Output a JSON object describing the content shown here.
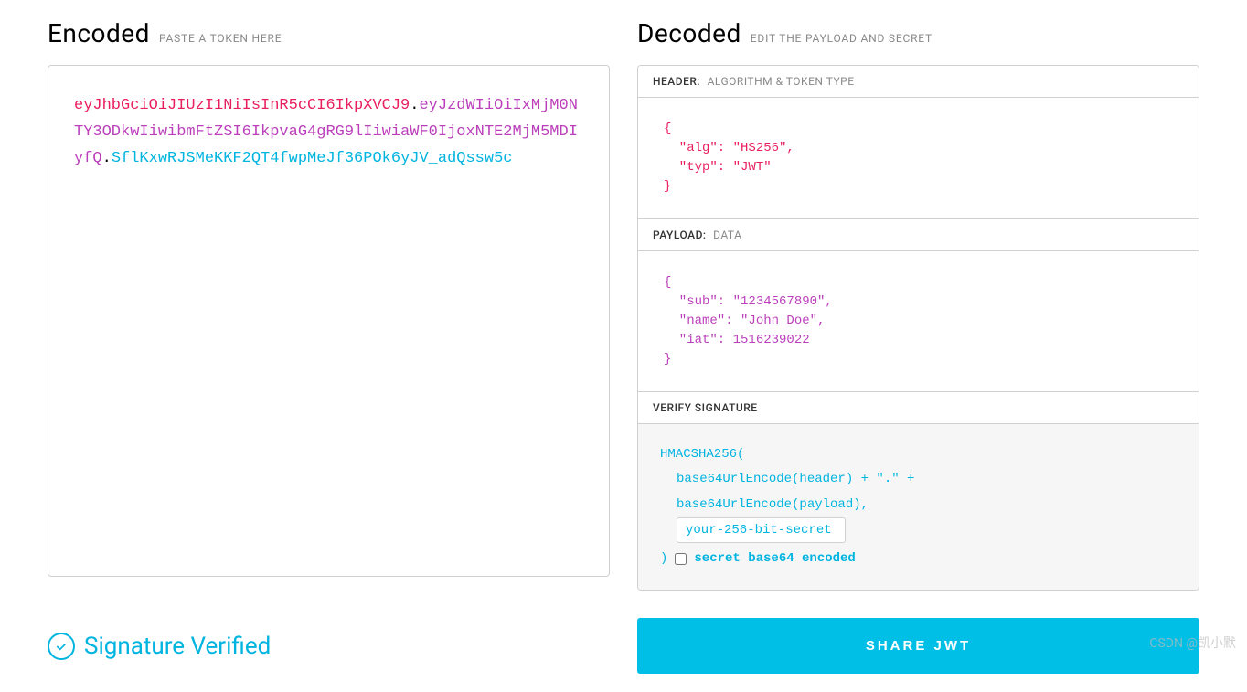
{
  "encoded": {
    "title": "Encoded",
    "subtitle": "PASTE A TOKEN HERE",
    "token_header": "eyJhbGciOiJIUzI1NiIsInR5cCI6IkpXVCJ9",
    "token_payload": "eyJzdWIiOiIxMjM0NTY3ODkwIiwibmFtZSI6IkpvaG4gRG9lIiwiaWF0IjoxNTE2MjM5MDIyfQ",
    "token_signature": "SflKxwRJSMeKKF2QT4fwpMeJf36POk6yJV_adQssw5c"
  },
  "decoded": {
    "title": "Decoded",
    "subtitle": "EDIT THE PAYLOAD AND SECRET",
    "header_label": "HEADER:",
    "header_sub": "ALGORITHM & TOKEN TYPE",
    "header_json": "{\n  \"alg\": \"HS256\",\n  \"typ\": \"JWT\"\n}",
    "payload_label": "PAYLOAD:",
    "payload_sub": "DATA",
    "payload_json": "{\n  \"sub\": \"1234567890\",\n  \"name\": \"John Doe\",\n  \"iat\": 1516239022\n}",
    "signature_label": "VERIFY SIGNATURE",
    "signature": {
      "line1": "HMACSHA256(",
      "line2": "base64UrlEncode(header) + \".\" +",
      "line3": "base64UrlEncode(payload),",
      "secret_value": "your-256-bit-secret",
      "close": ")",
      "checkbox_label": "secret base64 encoded"
    }
  },
  "footer": {
    "verified_text": "Signature Verified",
    "share_button": "SHARE JWT"
  },
  "watermark": "CSDN @凯小默"
}
